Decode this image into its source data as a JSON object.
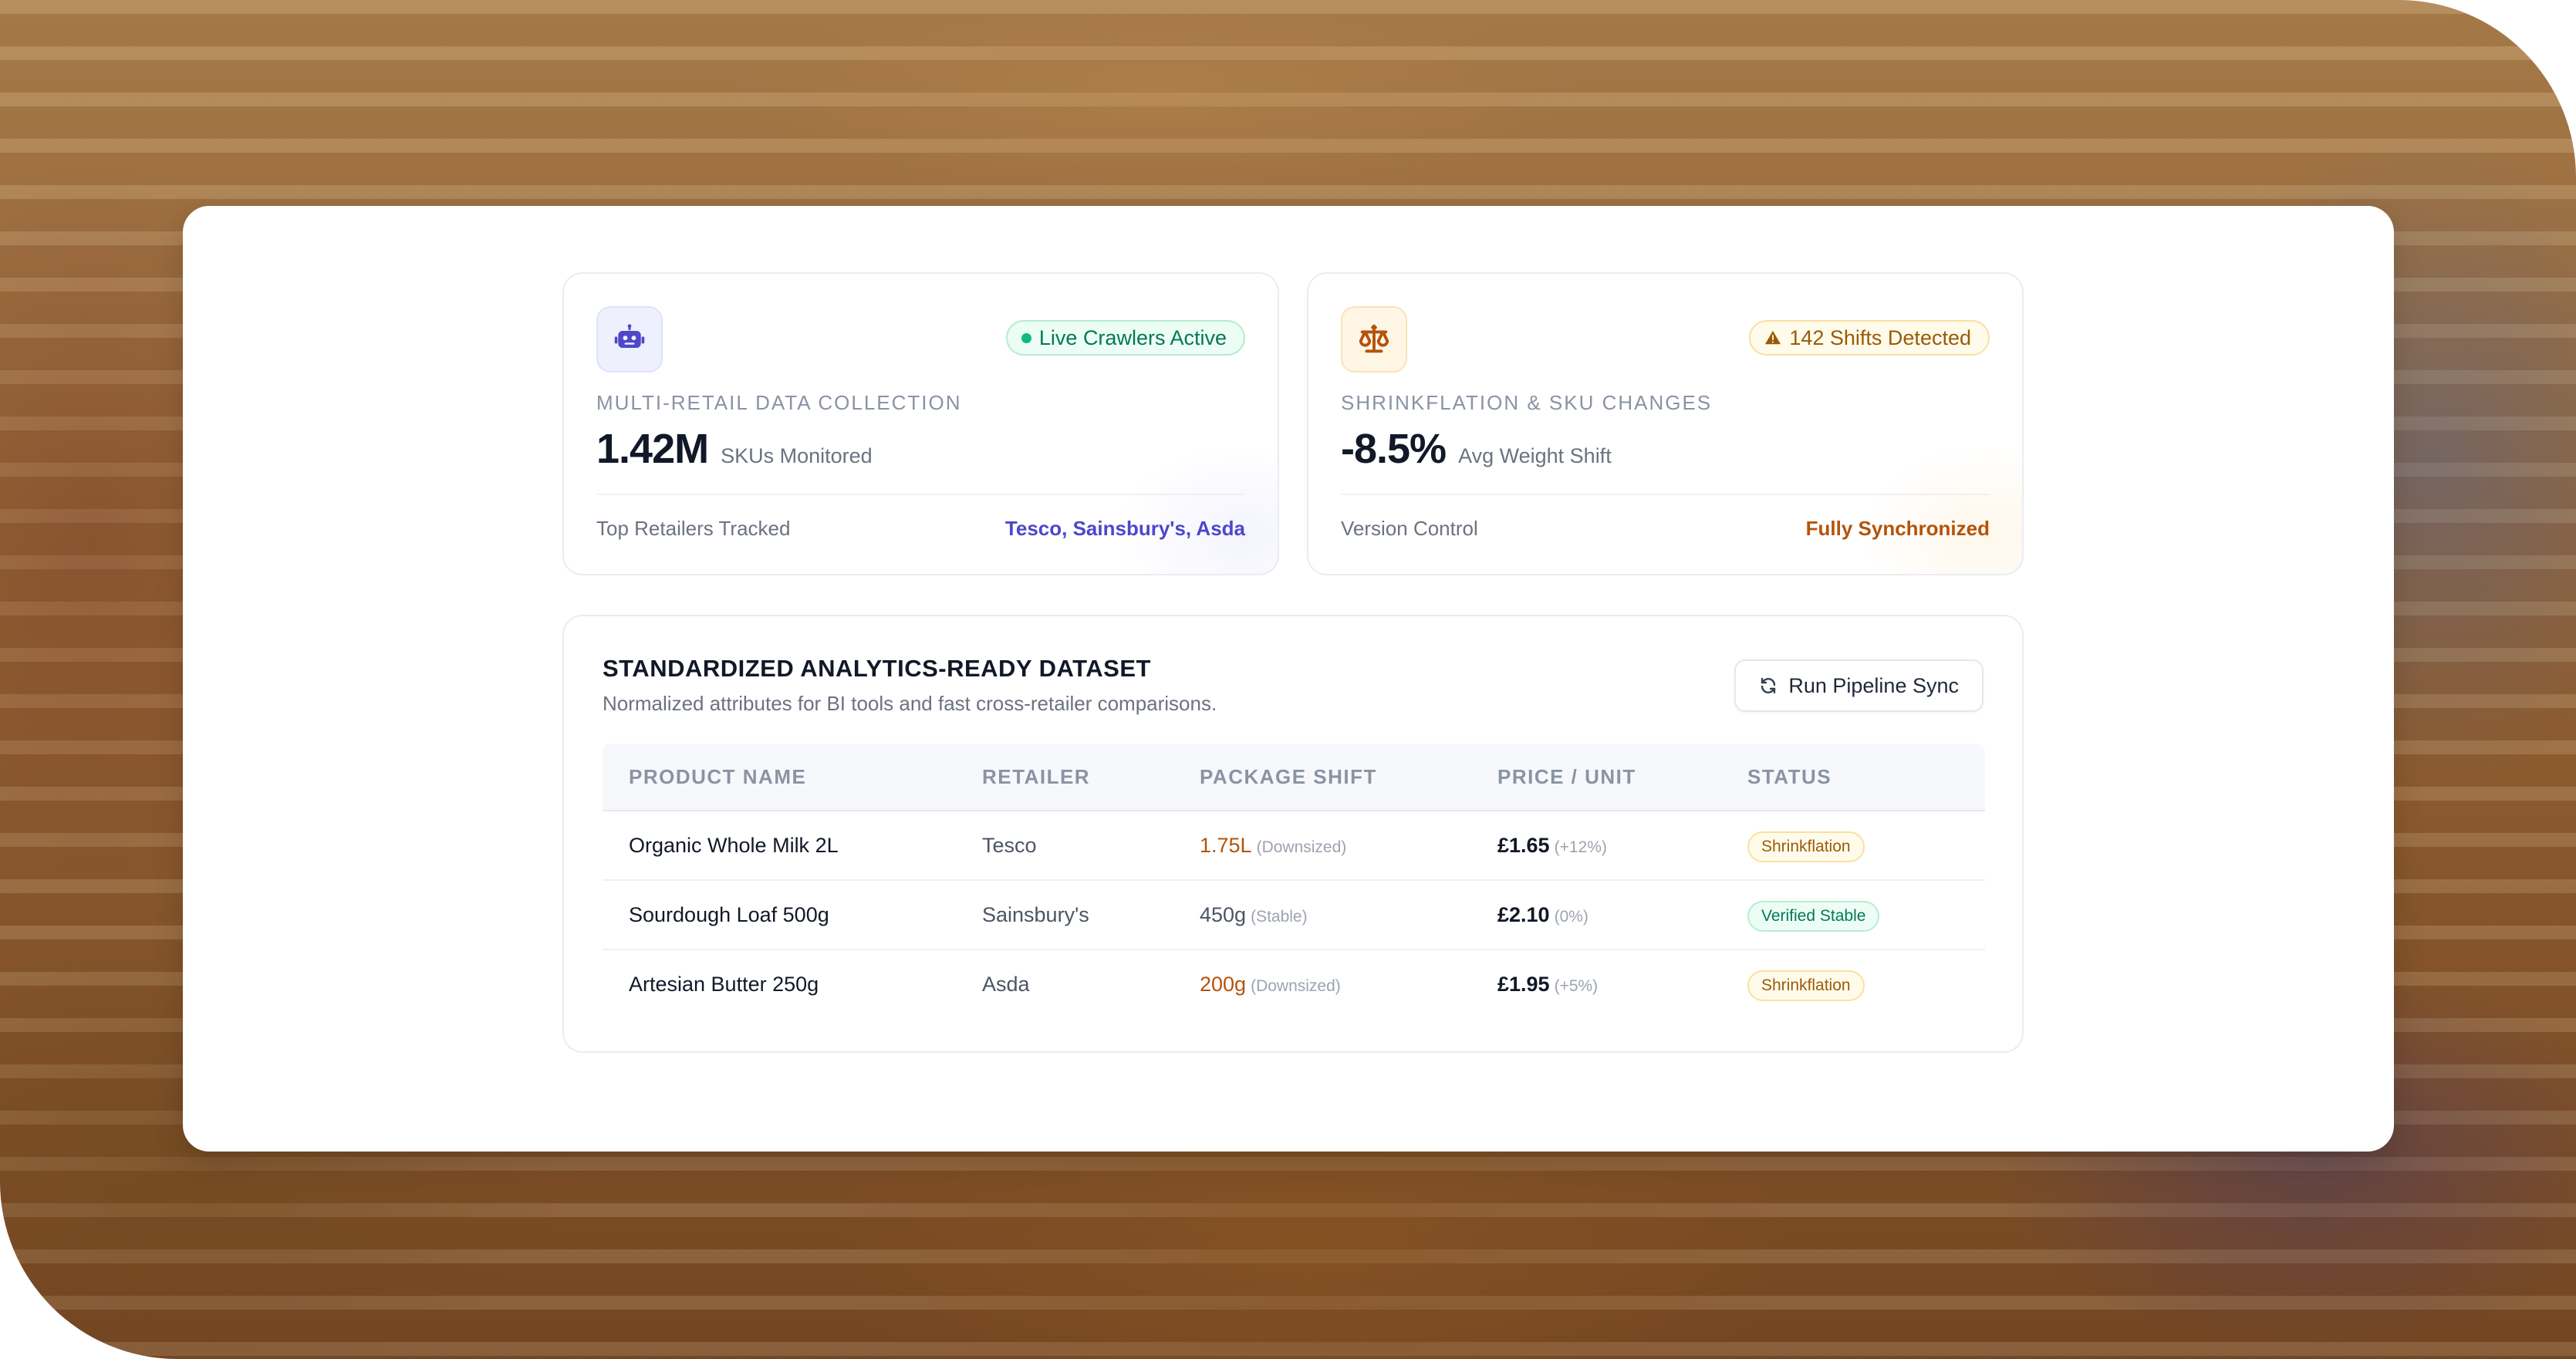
{
  "collection_card": {
    "icon": "robot-icon",
    "status_pill": "Live Crawlers Active",
    "eyebrow": "MULTI-RETAIL DATA COLLECTION",
    "metric_value": "1.42M",
    "metric_label": "SKUs Monitored",
    "footer_label": "Top Retailers Tracked",
    "footer_value": "Tesco, Sainsbury's, Asda"
  },
  "shrink_card": {
    "icon": "scale-icon",
    "status_pill": "142 Shifts Detected",
    "eyebrow": "SHRINKFLATION & SKU CHANGES",
    "metric_value": "-8.5%",
    "metric_label": "Avg Weight Shift",
    "footer_label": "Version Control",
    "footer_value": "Fully Synchronized"
  },
  "dataset": {
    "title": "STANDARDIZED ANALYTICS-READY DATASET",
    "subtitle": "Normalized attributes for BI tools and fast cross-retailer comparisons.",
    "sync_button": "Run Pipeline Sync",
    "columns": [
      "PRODUCT NAME",
      "RETAILER",
      "PACKAGE SHIFT",
      "PRICE / UNIT",
      "STATUS"
    ],
    "rows": [
      {
        "product": "Organic Whole Milk 2L",
        "retailer": "Tesco",
        "shift": "1.75L",
        "shift_note": "(Downsized)",
        "price": "£1.65",
        "price_note": "(+12%)",
        "status": "Shrinkflation"
      },
      {
        "product": "Sourdough Loaf 500g",
        "retailer": "Sainsbury's",
        "shift": "450g",
        "shift_note": "(Stable)",
        "price": "£2.10",
        "price_note": "(0%)",
        "status": "Verified Stable"
      },
      {
        "product": "Artesian Butter 250g",
        "retailer": "Asda",
        "shift": "200g",
        "shift_note": "(Downsized)",
        "price": "£1.95",
        "price_note": "(+5%)",
        "status": "Shrinkflation"
      }
    ]
  },
  "colors": {
    "accent_indigo": "#4f46c8",
    "accent_amber": "#b45309",
    "success_green": "#047857"
  }
}
